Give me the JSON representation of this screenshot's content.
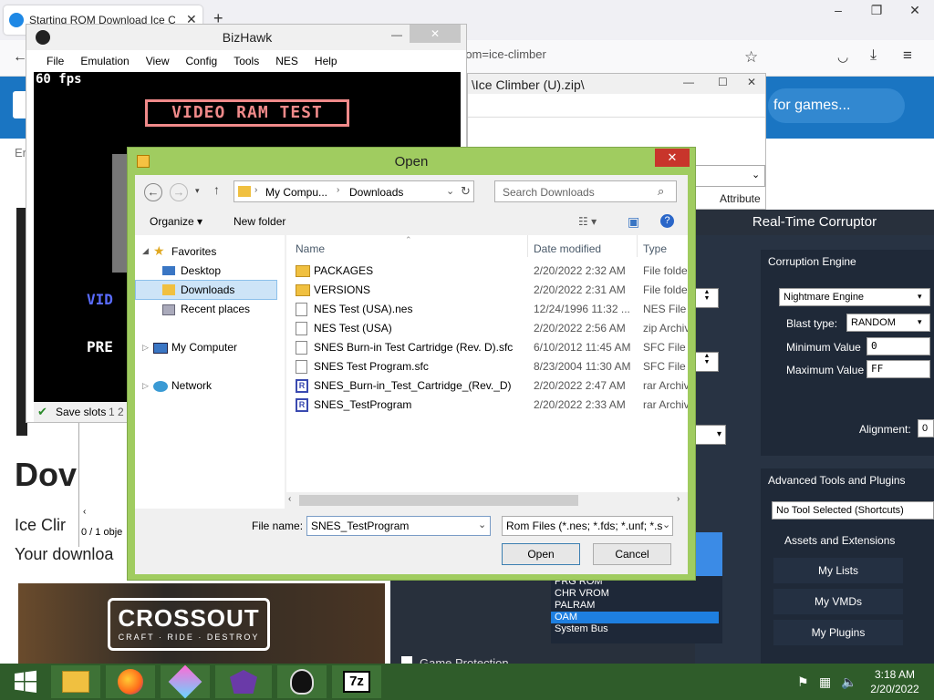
{
  "browser": {
    "tab_title": "Starting ROM Download Ice Clim",
    "url_fragment": "rom=ice-climber",
    "search_label": "for games...",
    "partial_left_text": "Er",
    "heading_partial": "Dov",
    "para1_partial": "Ice Clir",
    "para2_partial": "Your downloa",
    "banner_title": "CROSSOUT",
    "banner_sub": "CRAFT · RIDE · DESTROY"
  },
  "zipwin": {
    "path": "\\Ice Climber (U).zip\\",
    "column": "Attribute",
    "status": "0 / 1 obje"
  },
  "bizhawk": {
    "title": "BizHawk",
    "menu": [
      "File",
      "Emulation",
      "View",
      "Config",
      "Tools",
      "NES",
      "Help"
    ],
    "fps": "60 fps",
    "banner": "VIDEO RAM TEST",
    "vid_partial": "VID",
    "pre_partial": "PRE",
    "status_label": "Save slots",
    "status_nums": "1  2"
  },
  "rtc": {
    "title": "Real-Time Corruptor",
    "engine_header": "Corruption Engine",
    "engine_value": "Nightmare Engine",
    "blast_label": "Blast type:",
    "blast_value": "RANDOM",
    "min_label": "Minimum Value",
    "min_value": "0",
    "max_label": "Maximum Value",
    "max_value": "FF",
    "alignment_label": "Alignment:",
    "alignment_value": "0",
    "adv_header": "Advanced Tools and Plugins",
    "tool_select": "No Tool Selected (Shortcuts)",
    "assets_label": "Assets and Extensions",
    "btn_lists": "My Lists",
    "btn_vmds": "My VMDs",
    "btn_plugins": "My Plugins",
    "domains": [
      "PRG ROM",
      "CHR VROM",
      "PALRAM",
      "OAM",
      "System Bus"
    ],
    "selected_domain": "OAM",
    "game_protection": "Game Protection"
  },
  "dialog": {
    "title": "Open",
    "breadcrumb": [
      "My Compu...",
      "Downloads"
    ],
    "search_placeholder": "Search Downloads",
    "organize": "Organize",
    "new_folder": "New folder",
    "nav": {
      "favorites": "Favorites",
      "desktop": "Desktop",
      "downloads": "Downloads",
      "recent": "Recent places",
      "computer": "My Computer",
      "network": "Network"
    },
    "columns": {
      "name": "Name",
      "date": "Date modified",
      "type": "Type"
    },
    "files": [
      {
        "name": "PACKAGES",
        "date": "2/20/2022 2:32 AM",
        "type": "File folder",
        "icon": "folder"
      },
      {
        "name": "VERSIONS",
        "date": "2/20/2022 2:31 AM",
        "type": "File folder",
        "icon": "folder"
      },
      {
        "name": "NES Test (USA).nes",
        "date": "12/24/1996 11:32 ...",
        "type": "NES File",
        "icon": "file"
      },
      {
        "name": "NES Test (USA)",
        "date": "2/20/2022 2:56 AM",
        "type": "zip Archive",
        "icon": "zip"
      },
      {
        "name": "SNES Burn-in Test Cartridge (Rev. D).sfc",
        "date": "6/10/2012 11:45 AM",
        "type": "SFC File",
        "icon": "file"
      },
      {
        "name": "SNES Test Program.sfc",
        "date": "8/23/2004 11:30 AM",
        "type": "SFC File",
        "icon": "file"
      },
      {
        "name": "SNES_Burn-in_Test_Cartridge_(Rev._D)",
        "date": "2/20/2022 2:47 AM",
        "type": "rar Archive",
        "icon": "rar"
      },
      {
        "name": "SNES_TestProgram",
        "date": "2/20/2022 2:33 AM",
        "type": "rar Archive",
        "icon": "rar"
      }
    ],
    "filename_label": "File name:",
    "filename_value": "SNES_TestProgram",
    "filter_value": "Rom Files (*.nes; *.fds; *.unf; *.s",
    "open_label": "Open",
    "cancel_label": "Cancel"
  },
  "taskbar": {
    "time": "3:18 AM",
    "date": "2/20/2022"
  }
}
